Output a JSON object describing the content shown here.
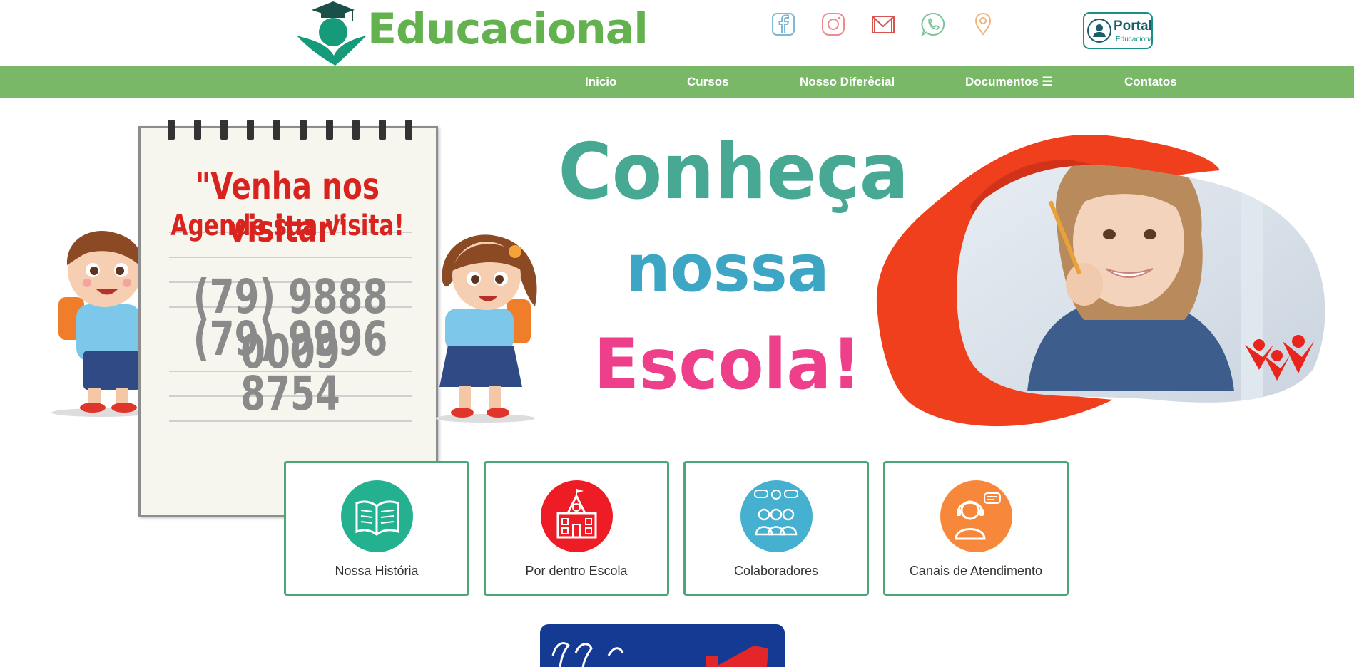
{
  "brand": {
    "name": "Educacional"
  },
  "social_icons": [
    "facebook-icon",
    "instagram-icon",
    "mail-icon",
    "whatsapp-icon",
    "location-pin-icon"
  ],
  "portal": {
    "title": "Portal",
    "subtitle": "Educacional"
  },
  "nav": {
    "items": [
      {
        "label": "Inicio"
      },
      {
        "label": "Cursos"
      },
      {
        "label": "Nosso Diferêcial"
      },
      {
        "label": "Documentos ☰"
      },
      {
        "label": "Contatos"
      }
    ]
  },
  "banner": {
    "notepad": {
      "title": "\"Venha nos visitar\"",
      "subtitle": "Agende sua visita!",
      "phone_1": "(79) 9888 0009",
      "phone_2": "(79) 9996 8754"
    },
    "hero": {
      "line_1": "Conheça",
      "line_2": "nossa",
      "line_3": "Escola!"
    },
    "colors": {
      "line_1": "#47a994",
      "line_2": "#3ea6c5",
      "line_3": "#ee3f8b",
      "blob": "#ef3f1c"
    }
  },
  "cards": [
    {
      "label": "Nossa História",
      "icon": "open-book-icon",
      "color": "#23b18f"
    },
    {
      "label": "Por dentro Escola",
      "icon": "school-building-icon",
      "color": "#ee1c24"
    },
    {
      "label": "Colaboradores",
      "icon": "team-icon",
      "color": "#45b0cf"
    },
    {
      "label": "Canais de Atendimento",
      "icon": "support-headset-icon",
      "color": "#f7883b"
    }
  ],
  "colors": {
    "nav_background": "#78b866",
    "brand_green": "#63b24f",
    "card_border": "#4aa877",
    "notice_background": "#143a93"
  }
}
